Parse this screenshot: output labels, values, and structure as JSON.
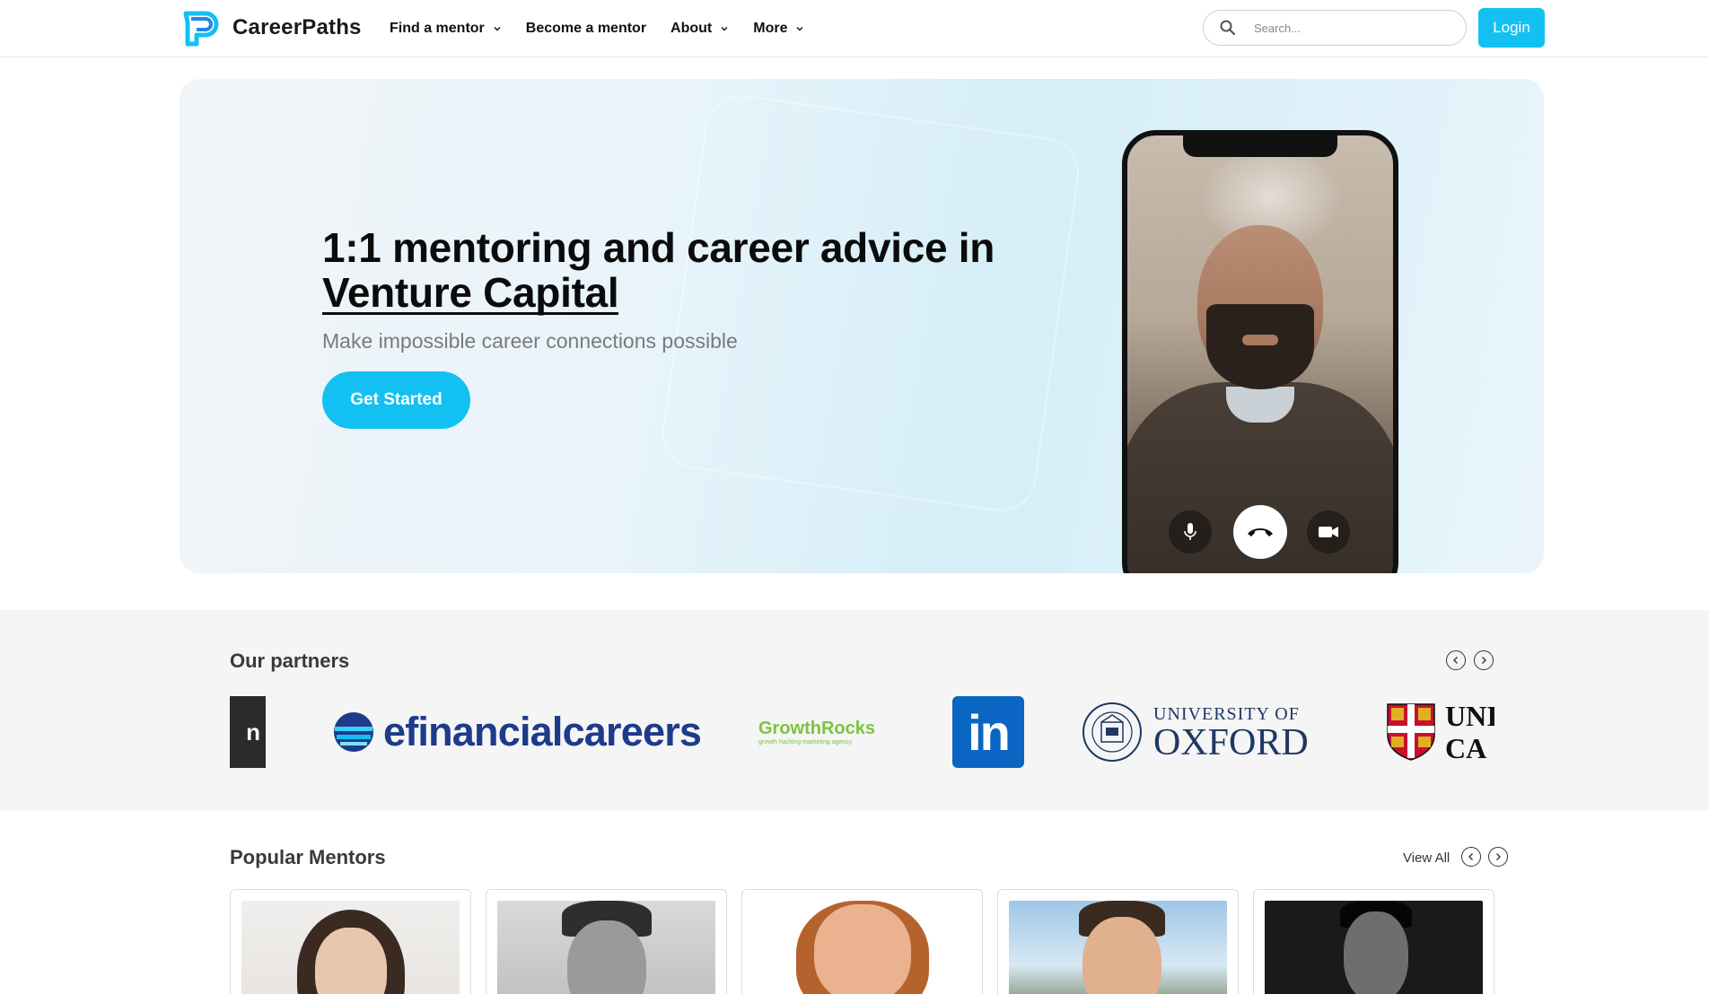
{
  "brand": {
    "name": "CareerPaths",
    "accent": "#13c0f2"
  },
  "nav": {
    "items": [
      {
        "label": "Find a mentor",
        "has_dropdown": true
      },
      {
        "label": "Become a mentor",
        "has_dropdown": false
      },
      {
        "label": "About",
        "has_dropdown": true
      },
      {
        "label": "More",
        "has_dropdown": true
      }
    ]
  },
  "search": {
    "placeholder": "Search..."
  },
  "login": {
    "label": "Login"
  },
  "hero": {
    "title_line1": "1:1 mentoring and career advice in",
    "title_accent": "Venture Capital",
    "subtitle": "Make impossible career connections possible",
    "cta_label": "Get Started",
    "call_controls": [
      "microphone-icon",
      "end-call-icon",
      "video-camera-icon"
    ]
  },
  "partners": {
    "title": "Our partners",
    "logos": [
      {
        "name": "partial-logo",
        "text": "n"
      },
      {
        "name": "efinancialcareers",
        "text": "efinancialcareers"
      },
      {
        "name": "growthrocks",
        "text": "GrowthRocks",
        "tagline": "growth hacking marketing agency"
      },
      {
        "name": "linkedin",
        "text": "in"
      },
      {
        "name": "university-of-oxford",
        "line1": "UNIVERSITY OF",
        "line2": "OXFORD"
      },
      {
        "name": "university-of-cambridge",
        "line1": "UNI",
        "line2": "CA"
      }
    ]
  },
  "mentors": {
    "title": "Popular Mentors",
    "view_all_label": "View All",
    "cards": [
      {
        "photo": "woman-dark-hair"
      },
      {
        "photo": "man-grayscale-beard"
      },
      {
        "photo": "man-ginger-beard"
      },
      {
        "photo": "man-outdoor"
      },
      {
        "photo": "man-black-white-portrait"
      }
    ]
  }
}
